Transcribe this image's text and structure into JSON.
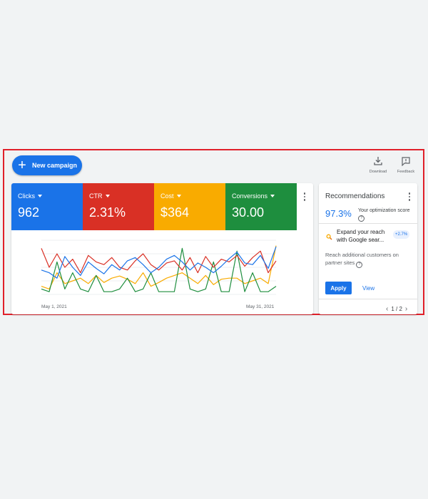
{
  "toolbar": {
    "new_campaign_label": "New campaign",
    "download_label": "Download",
    "feedback_label": "Feedback"
  },
  "metrics": [
    {
      "name": "Clicks",
      "value": "962",
      "color": "#1a73e8"
    },
    {
      "name": "CTR",
      "value": "2.31%",
      "color": "#d93025"
    },
    {
      "name": "Cost",
      "value": "$364",
      "color": "#f9ab00"
    },
    {
      "name": "Conversions",
      "value": "30.00",
      "color": "#1e8e3e"
    }
  ],
  "chart_data": {
    "type": "line",
    "x_start_label": "May 1, 2021",
    "x_end_label": "May 31, 2021",
    "series": [
      {
        "name": "Clicks",
        "color": "#1a73e8",
        "values": [
          45,
          40,
          30,
          70,
          50,
          35,
          60,
          48,
          38,
          55,
          45,
          62,
          68,
          55,
          40,
          50,
          65,
          72,
          60,
          45,
          58,
          50,
          40,
          52,
          66,
          78,
          58,
          55,
          72,
          48,
          88
        ]
      },
      {
        "name": "CTR",
        "color": "#d93025",
        "values": [
          85,
          50,
          75,
          50,
          65,
          40,
          72,
          60,
          55,
          68,
          50,
          45,
          62,
          75,
          55,
          45,
          58,
          62,
          45,
          68,
          40,
          70,
          50,
          65,
          60,
          72,
          52,
          68,
          80,
          40,
          62
        ]
      },
      {
        "name": "Cost",
        "color": "#f9ab00",
        "values": [
          15,
          10,
          40,
          20,
          25,
          30,
          20,
          35,
          22,
          30,
          34,
          28,
          20,
          40,
          15,
          22,
          30,
          35,
          40,
          30,
          20,
          35,
          18,
          28,
          30,
          30,
          20,
          25,
          30,
          20,
          90
        ]
      },
      {
        "name": "Conversions",
        "color": "#1e8e3e",
        "values": [
          10,
          5,
          60,
          10,
          40,
          10,
          5,
          35,
          5,
          5,
          10,
          30,
          5,
          10,
          40,
          5,
          5,
          5,
          85,
          10,
          5,
          10,
          60,
          5,
          5,
          80,
          5,
          40,
          5,
          5,
          15
        ]
      }
    ]
  },
  "recommendations": {
    "title": "Recommendations",
    "score": "97.3%",
    "score_label": "Your optimization score",
    "help_glyph": "?",
    "item_title": "Expand your reach with Google sear...",
    "item_badge": "+2.7%",
    "item_desc": "Reach additional customers on partner sites",
    "apply_label": "Apply",
    "view_label": "View",
    "pager_text": "1 / 2",
    "prev_glyph": "‹",
    "next_glyph": "›"
  }
}
